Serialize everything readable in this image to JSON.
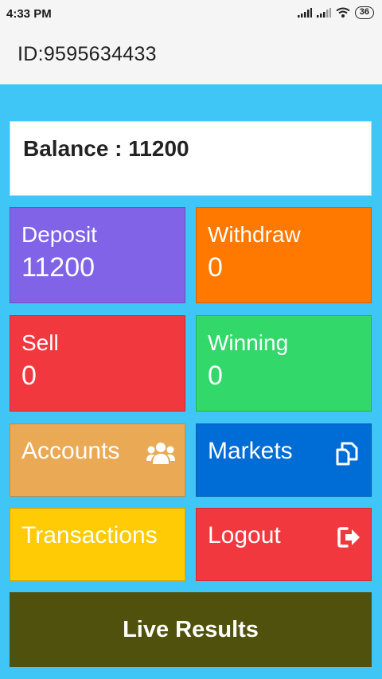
{
  "status": {
    "time": "4:33 PM",
    "battery": "36"
  },
  "header": {
    "user_id": "ID:9595634433"
  },
  "balance": {
    "text": "Balance : 11200"
  },
  "stats": {
    "deposit": {
      "label": "Deposit",
      "value": "11200",
      "color": "#8063e6"
    },
    "withdraw": {
      "label": "Withdraw",
      "value": "0",
      "color": "#ff7800"
    },
    "sell": {
      "label": "Sell",
      "value": "0",
      "color": "#f2383f"
    },
    "winning": {
      "label": "Winning",
      "value": "0",
      "color": "#33d86a"
    }
  },
  "menu": {
    "accounts": {
      "label": "Accounts",
      "icon": "users-icon",
      "color": "#eaaa55"
    },
    "markets": {
      "label": "Markets",
      "icon": "copy-icon",
      "color": "#006dd6"
    },
    "transactions": {
      "label": "Transactions",
      "color": "#ffcb05"
    },
    "logout": {
      "label": "Logout",
      "icon": "sign-out-icon",
      "color": "#f2383f"
    }
  },
  "live_results": {
    "label": "Live Results",
    "color": "#4f510c"
  }
}
